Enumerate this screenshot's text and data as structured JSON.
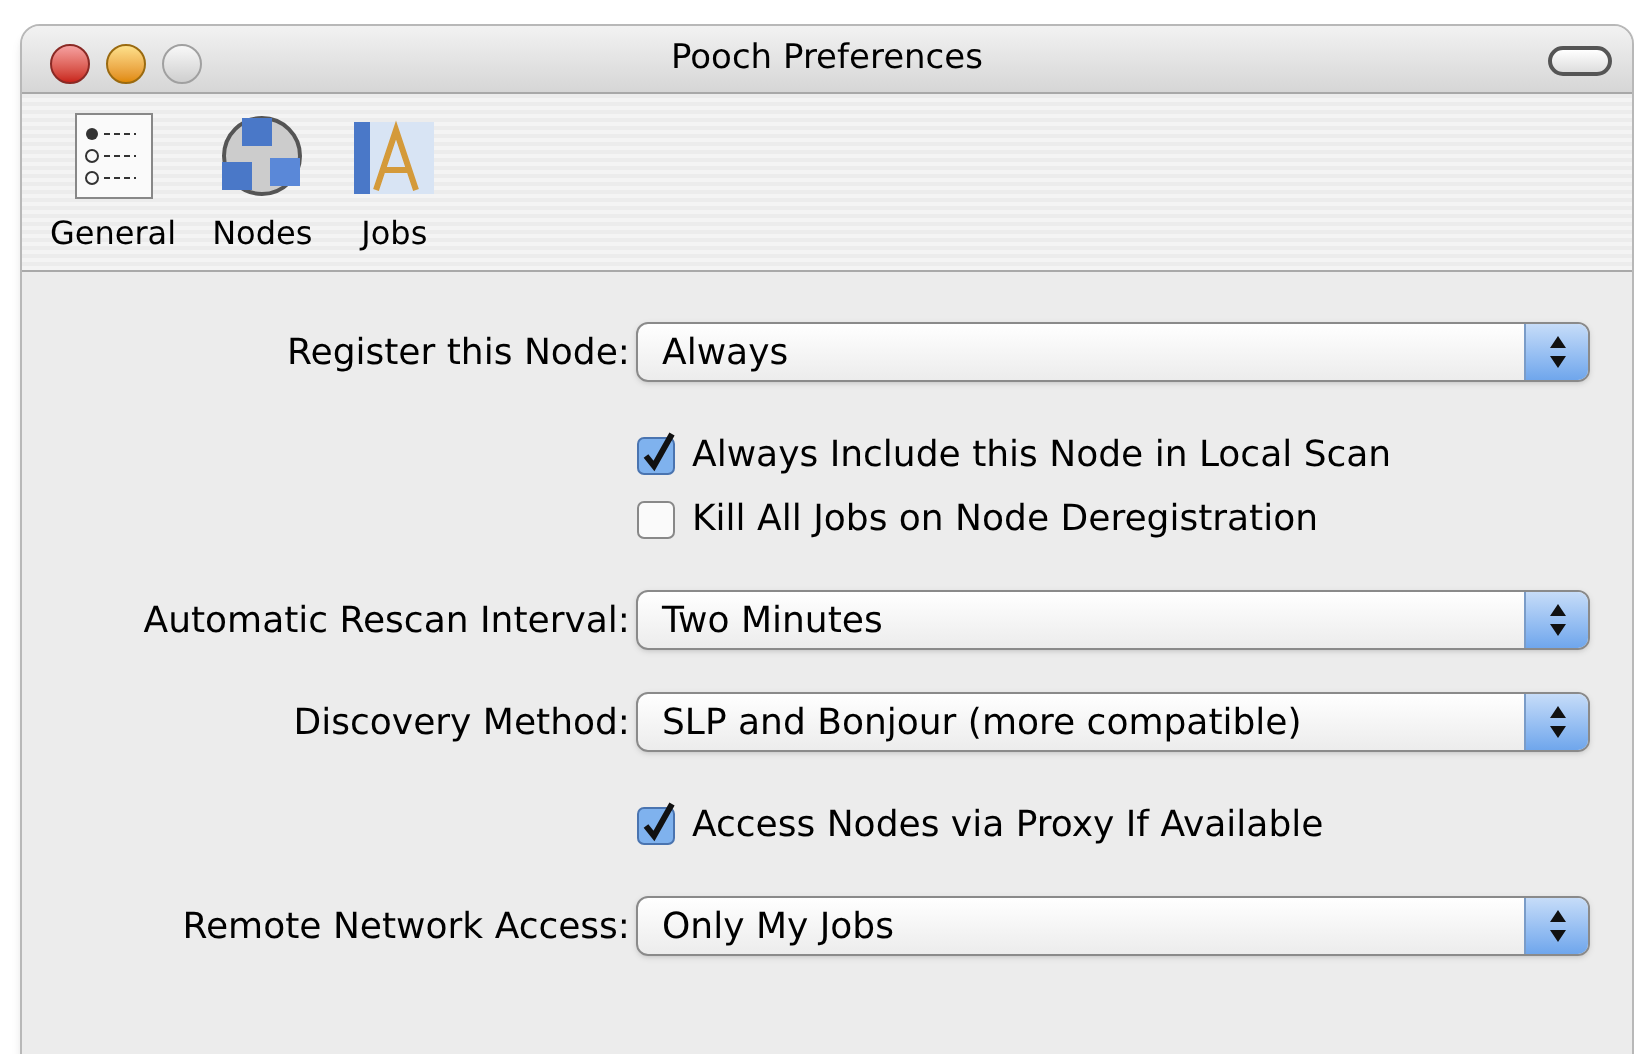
{
  "window": {
    "title": "Pooch Preferences"
  },
  "toolbar": [
    {
      "label": "General",
      "kind": "list"
    },
    {
      "label": "Nodes",
      "kind": "network"
    },
    {
      "label": "Jobs",
      "kind": "app"
    }
  ],
  "form": [
    {
      "kind": "popup",
      "label": "Register this Node:",
      "value": "Always"
    },
    {
      "kind": "checkbox",
      "label": "Always Include this Node in Local Scan",
      "checked": true
    },
    {
      "kind": "checkbox",
      "label": "Kill All Jobs on Node Deregistration",
      "checked": false
    },
    {
      "kind": "popup",
      "label": "Automatic Rescan Interval:",
      "value": "Two Minutes"
    },
    {
      "kind": "popup",
      "label": "Discovery Method:",
      "value": "SLP and Bonjour (more compatible)"
    },
    {
      "kind": "checkbox",
      "label": "Access Nodes via Proxy If Available",
      "checked": true
    },
    {
      "kind": "popup",
      "label": "Remote Network Access:",
      "value": "Only My Jobs"
    }
  ]
}
